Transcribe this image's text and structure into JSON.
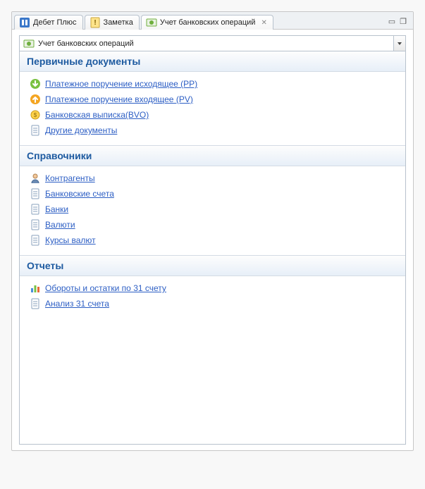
{
  "tabs": [
    {
      "label": "Дебет Плюс",
      "icon": "app-icon"
    },
    {
      "label": "Заметка",
      "icon": "note-icon"
    },
    {
      "label": "Учет банковских операций",
      "icon": "bank-ops-icon",
      "closable": true,
      "active": true
    }
  ],
  "module_selector": {
    "icon": "bank-ops-icon",
    "value": "Учет банковских операций"
  },
  "sections": [
    {
      "title": "Первичные документы",
      "items": [
        {
          "icon": "arrow-down-green-icon",
          "label": "Платежное поручение исходящее (PP)"
        },
        {
          "icon": "arrow-up-orange-icon",
          "label": "Платежное поручение входящее (PV)"
        },
        {
          "icon": "coin-icon",
          "label": "Банковская выписка(BVO)"
        },
        {
          "icon": "doc-icon",
          "label": "Другие документы"
        }
      ]
    },
    {
      "title": "Справочники",
      "items": [
        {
          "icon": "person-icon",
          "label": "Контрагенты"
        },
        {
          "icon": "doc-icon",
          "label": "Банковские счета"
        },
        {
          "icon": "doc-icon",
          "label": "Банки"
        },
        {
          "icon": "doc-icon",
          "label": "Валюти"
        },
        {
          "icon": "doc-icon",
          "label": "Курсы валют"
        }
      ]
    },
    {
      "title": "Отчеты",
      "items": [
        {
          "icon": "chart-icon",
          "label": "Обороты и остатки по 31 счету"
        },
        {
          "icon": "doc-icon",
          "label": "Анализ 31 счета"
        }
      ]
    }
  ]
}
